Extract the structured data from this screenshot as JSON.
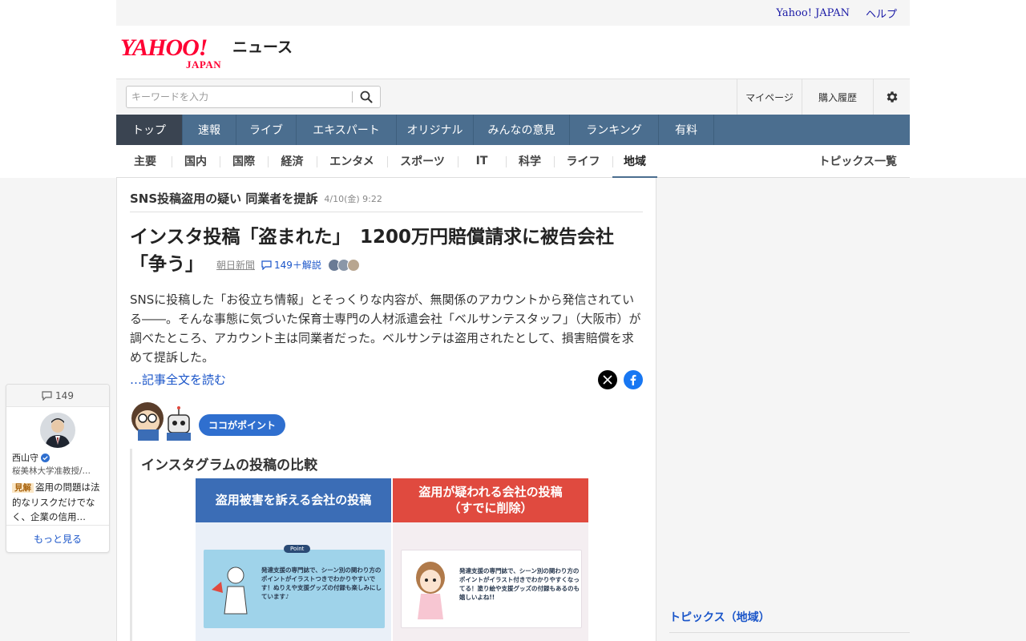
{
  "util": {
    "yahoo_japan": "Yahoo! JAPAN",
    "help": "ヘルプ"
  },
  "logo": {
    "yahoo": "YAHOO!",
    "japan": "JAPAN",
    "news": "ニュース"
  },
  "search": {
    "placeholder": "キーワードを入力",
    "value": "",
    "mypage": "マイページ",
    "history": "購入履歴"
  },
  "main_nav": [
    "トップ",
    "速報",
    "ライブ",
    "エキスパート",
    "オリジナル",
    "みんなの意見",
    "ランキング",
    "有料"
  ],
  "main_nav_active": "トップ",
  "sub_nav": [
    "主要",
    "国内",
    "国際",
    "経済",
    "エンタメ",
    "スポーツ",
    "IT",
    "科学",
    "ライフ",
    "地域"
  ],
  "sub_nav_active": "地域",
  "sub_nav_all": "トピックス一覧",
  "article": {
    "topic_title": "SNS投稿盗用の疑い 同業者を提訴",
    "topic_date": "4/10(金) 9:22",
    "headline": "インスタ投稿「盗まれた」　1200万円賠償請求に被告会社「争う」",
    "source": "朝日新聞",
    "comments": "149＋解説",
    "body": "SNSに投稿した「お役立ち情報」とそっくりな内容が、無関係のアカウントから発信されている――。そんな事態に気づいた保育士専門の人材派遣会社「ベルサンテスタッフ」（大阪市）が調べたところ、アカウント主は同業者だった。ベルサンテは盗用されたとして、損害賠償を求めて提訴した。",
    "read_more": "…記事全文を読む"
  },
  "point": {
    "badge": "ココがポイント",
    "title": "インスタグラムの投稿の比較",
    "left_header": "盗用被害を訴える会社の投稿",
    "right_header_1": "盗用が疑われる会社の投稿",
    "right_header_2": "（すでに削除）",
    "left_card_label": "Point",
    "left_card_text": "発達支援の専門誌で、シーン別の関わり方のポイントがイラストつきでわかりやすいです！ぬりえや支援グッズの付録も楽しみにしています♪",
    "right_card_text": "発達支援の専門誌で、シーン別の関わり方のポイントがイラスト付きでわかりやすくなってる！塗り絵や支援グッズの付録もあるのも嬉しいよね!!"
  },
  "right_col": {
    "header": "トピックス（地域）"
  },
  "comment_widget": {
    "count": "149",
    "name": "西山守",
    "affiliation": "桜美林大学准教授/…",
    "badge": "見解",
    "text": "盗用の問題は法的なリスクだけでなく、企業の信用…",
    "more": "もっと見る"
  },
  "colors": {
    "nav": "#4b6e8f",
    "nav_active": "#3a4451",
    "link": "#1a55c9",
    "brand_red": "#ff0033"
  },
  "icons": [
    "search-icon",
    "gear-icon",
    "comment-icon",
    "x-icon",
    "facebook-icon",
    "verified-icon"
  ]
}
